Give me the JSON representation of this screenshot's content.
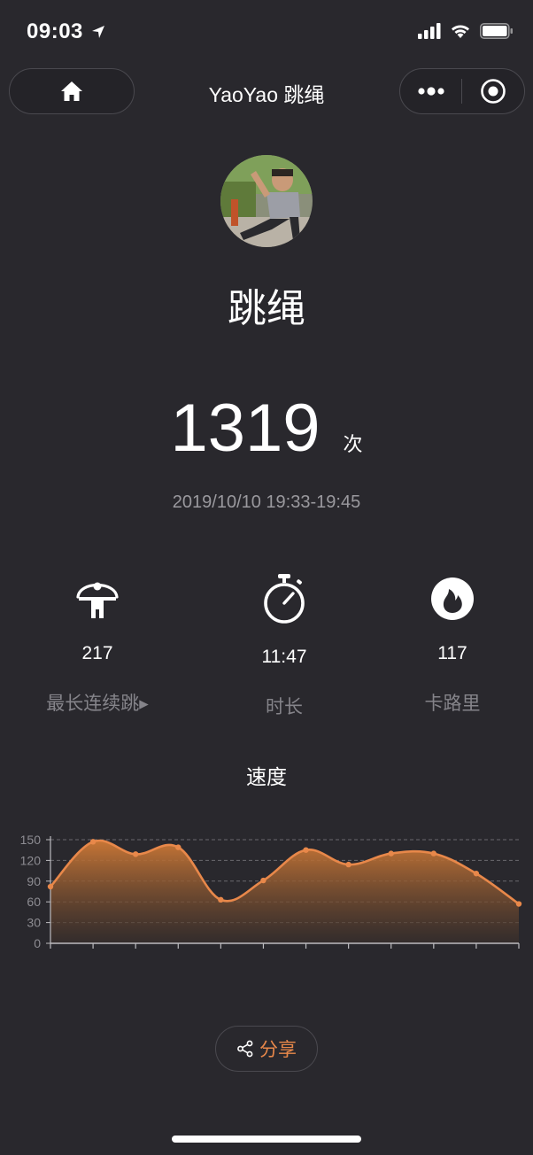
{
  "status_bar": {
    "time": "09:03"
  },
  "nav": {
    "title": "YaoYao 跳绳"
  },
  "activity": {
    "title": "跳绳",
    "count": "1319",
    "count_unit": "次",
    "session_time": "2019/10/10 19:33-19:45"
  },
  "stats": [
    {
      "value": "217",
      "label": "最长连续跳▸",
      "icon": "jump-rope-person-icon"
    },
    {
      "value": "11:47",
      "label": "时长",
      "icon": "stopwatch-icon"
    },
    {
      "value": "117",
      "label": "卡路里",
      "icon": "flame-icon"
    }
  ],
  "chart_title": "速度",
  "share_label": "分享",
  "colors": {
    "background": "#29282d",
    "accent": "#e8884a"
  },
  "chart_data": {
    "type": "area",
    "title": "速度",
    "xlabel": "",
    "ylabel": "",
    "ylim": [
      0,
      150
    ],
    "yticks": [
      "0",
      "30",
      "60",
      "90",
      "120",
      "150"
    ],
    "x": [
      0,
      1,
      2,
      3,
      4,
      5,
      6,
      7,
      8,
      9,
      10,
      11
    ],
    "series": [
      {
        "values": [
          82,
          147,
          129,
          139,
          63,
          91,
          135,
          114,
          130,
          130,
          101,
          57
        ]
      }
    ],
    "grid": true
  }
}
